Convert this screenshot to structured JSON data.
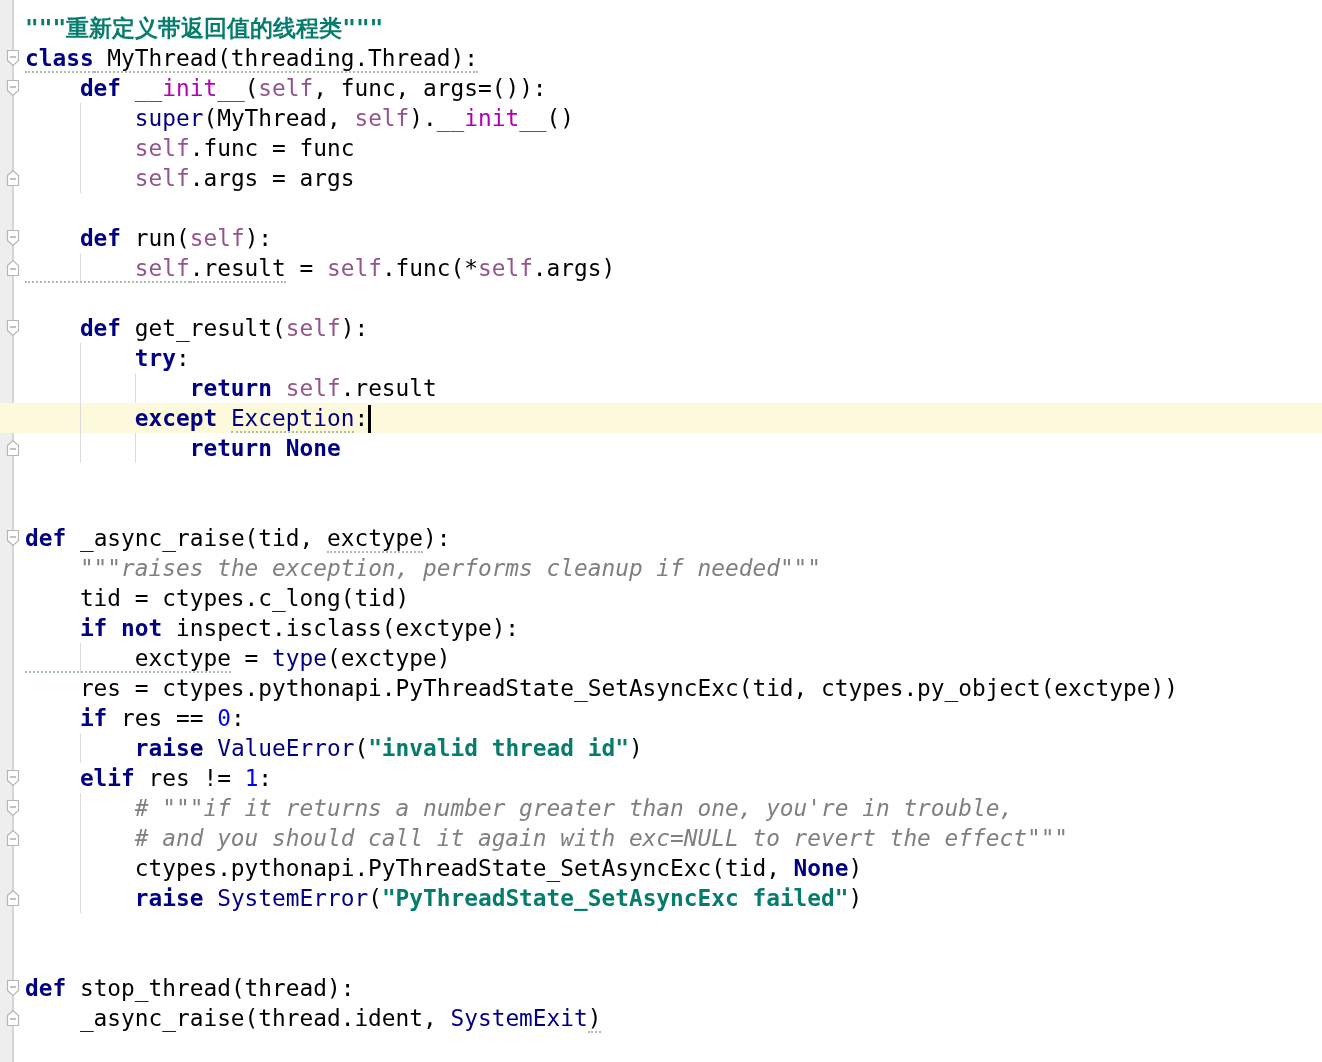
{
  "editor": {
    "lines": [
      {
        "kind": "code",
        "fold_start": false,
        "fold_end": false,
        "tokens": [
          {
            "text": "\"\"\"重新定义带返回值的线程类\"\"\"",
            "kind": "str"
          }
        ]
      },
      {
        "kind": "code",
        "fold_start": true,
        "fold_end": false,
        "tokens": [
          {
            "text": "class",
            "kind": "kw",
            "warning": true
          },
          {
            "text": " MyThread(threading.Thread):",
            "kind": "plain",
            "warning": true
          }
        ]
      },
      {
        "kind": "code",
        "fold_start": true,
        "fold_end": false,
        "tokens": [
          {
            "text": "    def ",
            "kind": "kw"
          },
          {
            "text": "__init__",
            "kind": "magic"
          },
          {
            "text": "(",
            "kind": "plain"
          },
          {
            "text": "self",
            "kind": "self"
          },
          {
            "text": ", func, args=()):",
            "kind": "plain"
          }
        ]
      },
      {
        "kind": "code",
        "fold_start": false,
        "fold_end": false,
        "tokens": [
          {
            "text": "        super",
            "kind": "builtin"
          },
          {
            "text": "(MyThread, ",
            "kind": "plain"
          },
          {
            "text": "self",
            "kind": "self"
          },
          {
            "text": ").",
            "kind": "plain"
          },
          {
            "text": "__init__",
            "kind": "magic"
          },
          {
            "text": "()",
            "kind": "plain"
          }
        ]
      },
      {
        "kind": "code",
        "fold_start": false,
        "fold_end": false,
        "tokens": [
          {
            "text": "        self",
            "kind": "self"
          },
          {
            "text": ".func = func",
            "kind": "plain"
          }
        ]
      },
      {
        "kind": "code",
        "fold_start": false,
        "fold_end": true,
        "tokens": [
          {
            "text": "        self",
            "kind": "self"
          },
          {
            "text": ".args = args",
            "kind": "plain"
          }
        ]
      },
      {
        "kind": "blank",
        "fold_start": false,
        "fold_end": false
      },
      {
        "kind": "code",
        "fold_start": true,
        "fold_end": false,
        "tokens": [
          {
            "text": "    def ",
            "kind": "kw"
          },
          {
            "text": "run(",
            "kind": "plain"
          },
          {
            "text": "self",
            "kind": "self"
          },
          {
            "text": "):",
            "kind": "plain"
          }
        ]
      },
      {
        "kind": "code",
        "fold_start": false,
        "fold_end": true,
        "tokens": [
          {
            "text": "        self",
            "kind": "self",
            "warning": true
          },
          {
            "text": ".result",
            "kind": "plain",
            "warning": true
          },
          {
            "text": " = ",
            "kind": "plain"
          },
          {
            "text": "self",
            "kind": "self"
          },
          {
            "text": ".func(*",
            "kind": "plain"
          },
          {
            "text": "self",
            "kind": "self"
          },
          {
            "text": ".args)",
            "kind": "plain"
          }
        ]
      },
      {
        "kind": "blank",
        "fold_start": false,
        "fold_end": false
      },
      {
        "kind": "code",
        "fold_start": true,
        "fold_end": false,
        "tokens": [
          {
            "text": "    def ",
            "kind": "kw"
          },
          {
            "text": "get_result(",
            "kind": "plain"
          },
          {
            "text": "self",
            "kind": "self"
          },
          {
            "text": "):",
            "kind": "plain"
          }
        ]
      },
      {
        "kind": "code",
        "fold_start": false,
        "fold_end": false,
        "tokens": [
          {
            "text": "        try",
            "kind": "kw"
          },
          {
            "text": ":",
            "kind": "plain"
          }
        ]
      },
      {
        "kind": "code",
        "fold_start": false,
        "fold_end": false,
        "tokens": [
          {
            "text": "            return ",
            "kind": "kw"
          },
          {
            "text": "self",
            "kind": "self"
          },
          {
            "text": ".result",
            "kind": "plain"
          }
        ]
      },
      {
        "kind": "code",
        "fold_start": false,
        "fold_end": false,
        "current": true,
        "tokens": [
          {
            "text": "        except ",
            "kind": "kw"
          },
          {
            "text": "Exception",
            "kind": "builtin",
            "warning": true
          },
          {
            "text": ":",
            "kind": "plain"
          }
        ]
      },
      {
        "kind": "code",
        "fold_start": false,
        "fold_end": true,
        "tokens": [
          {
            "text": "            return None",
            "kind": "kw"
          }
        ]
      },
      {
        "kind": "blank",
        "fold_start": false,
        "fold_end": false
      },
      {
        "kind": "blank",
        "fold_start": false,
        "fold_end": false
      },
      {
        "kind": "code",
        "fold_start": true,
        "fold_end": false,
        "tokens": [
          {
            "text": "def",
            "kind": "kw"
          },
          {
            "text": " _async_raise(tid, ",
            "kind": "plain"
          },
          {
            "text": "exctype",
            "kind": "plain",
            "warning": true
          },
          {
            "text": "):",
            "kind": "plain"
          }
        ]
      },
      {
        "kind": "code",
        "fold_start": false,
        "fold_end": false,
        "tokens": [
          {
            "text": "    \"\"\"",
            "kind": "quote"
          },
          {
            "text": "raises the exception, performs cleanup if needed",
            "kind": "comment"
          },
          {
            "text": "\"\"\"",
            "kind": "quote"
          }
        ]
      },
      {
        "kind": "code",
        "fold_start": false,
        "fold_end": false,
        "tokens": [
          {
            "text": "    tid = ctypes.c_long(tid)",
            "kind": "plain"
          }
        ]
      },
      {
        "kind": "code",
        "fold_start": false,
        "fold_end": false,
        "tokens": [
          {
            "text": "    if not",
            "kind": "kw"
          },
          {
            "text": " inspect.isclass(exctype):",
            "kind": "plain"
          }
        ]
      },
      {
        "kind": "code",
        "fold_start": false,
        "fold_end": false,
        "tokens": [
          {
            "text": "        exctype",
            "kind": "plain",
            "warning": true
          },
          {
            "text": " = ",
            "kind": "plain"
          },
          {
            "text": "type",
            "kind": "builtin"
          },
          {
            "text": "(exctype)",
            "kind": "plain"
          }
        ]
      },
      {
        "kind": "code",
        "fold_start": false,
        "fold_end": false,
        "tokens": [
          {
            "text": "    res = ctypes.pythonapi.PyThreadState_SetAsyncExc(tid, ctypes.py_object(exctype))",
            "kind": "plain"
          }
        ]
      },
      {
        "kind": "code",
        "fold_start": false,
        "fold_end": false,
        "tokens": [
          {
            "text": "    if",
            "kind": "kw"
          },
          {
            "text": " res == ",
            "kind": "plain"
          },
          {
            "text": "0",
            "kind": "num"
          },
          {
            "text": ":",
            "kind": "plain"
          }
        ]
      },
      {
        "kind": "code",
        "fold_start": false,
        "fold_end": false,
        "tokens": [
          {
            "text": "        raise ",
            "kind": "kw"
          },
          {
            "text": "ValueError",
            "kind": "builtin"
          },
          {
            "text": "(",
            "kind": "plain"
          },
          {
            "text": "\"invalid thread id\"",
            "kind": "str"
          },
          {
            "text": ")",
            "kind": "plain"
          }
        ]
      },
      {
        "kind": "code",
        "fold_start": true,
        "fold_end": false,
        "tokens": [
          {
            "text": "    elif",
            "kind": "kw"
          },
          {
            "text": " res != ",
            "kind": "plain"
          },
          {
            "text": "1",
            "kind": "num"
          },
          {
            "text": ":",
            "kind": "plain"
          }
        ]
      },
      {
        "kind": "code",
        "fold_start": true,
        "fold_end": false,
        "tokens": [
          {
            "text": "        # \"\"\"if it returns a number greater than one, you're in trouble,",
            "kind": "comment"
          }
        ]
      },
      {
        "kind": "code",
        "fold_start": false,
        "fold_end": true,
        "tokens": [
          {
            "text": "        # and you should call it again with exc=NULL to revert the effect\"\"\"",
            "kind": "comment"
          }
        ]
      },
      {
        "kind": "code",
        "fold_start": false,
        "fold_end": false,
        "tokens": [
          {
            "text": "        ctypes.pythonapi.PyThreadState_SetAsyncExc(tid, ",
            "kind": "plain"
          },
          {
            "text": "None",
            "kind": "kw"
          },
          {
            "text": ")",
            "kind": "plain"
          }
        ]
      },
      {
        "kind": "code",
        "fold_start": false,
        "fold_end": true,
        "tokens": [
          {
            "text": "        raise ",
            "kind": "kw"
          },
          {
            "text": "SystemError",
            "kind": "builtin"
          },
          {
            "text": "(",
            "kind": "plain"
          },
          {
            "text": "\"PyThreadState_SetAsyncExc failed\"",
            "kind": "str"
          },
          {
            "text": ")",
            "kind": "plain"
          }
        ]
      },
      {
        "kind": "blank",
        "fold_start": false,
        "fold_end": false
      },
      {
        "kind": "blank",
        "fold_start": false,
        "fold_end": false
      },
      {
        "kind": "code",
        "fold_start": true,
        "fold_end": false,
        "tokens": [
          {
            "text": "def",
            "kind": "kw"
          },
          {
            "text": " stop_thread(thread):",
            "kind": "plain"
          }
        ]
      },
      {
        "kind": "code",
        "fold_start": false,
        "fold_end": true,
        "tokens": [
          {
            "text": "    _async_raise(thread.ident, ",
            "kind": "plain"
          },
          {
            "text": "SystemExit",
            "kind": "builtin"
          },
          {
            "text": ")",
            "kind": "plain",
            "warning": true
          }
        ]
      }
    ]
  }
}
